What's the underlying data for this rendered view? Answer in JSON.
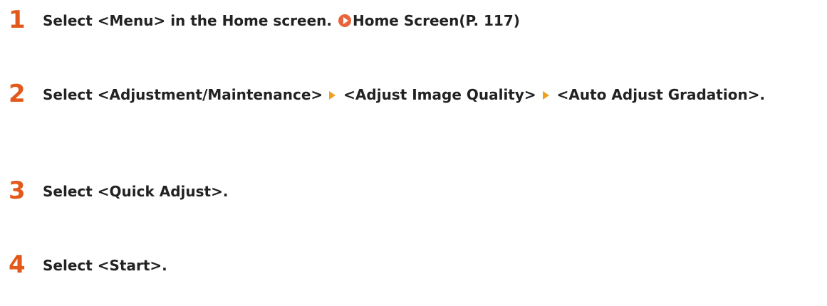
{
  "steps": [
    {
      "number": "1",
      "text": "Select <Menu> in the Home screen.",
      "link_label": "Home Screen(P. 117)"
    },
    {
      "number": "2",
      "part1": "Select <Adjustment/Maintenance>",
      "part2": "<Adjust Image Quality>",
      "part3": "<Auto Adjust Gradation>."
    },
    {
      "number": "3",
      "text": "Select <Quick Adjust>."
    },
    {
      "number": "4",
      "text": "Select <Start>."
    }
  ],
  "colors": {
    "step_number": "#e2591b",
    "link_icon": "#e8643c",
    "arrow_icon": "#f0a020",
    "text": "#222222"
  },
  "icons": {
    "link": "circle-play-icon",
    "separator": "right-triangle-arrow-icon"
  }
}
